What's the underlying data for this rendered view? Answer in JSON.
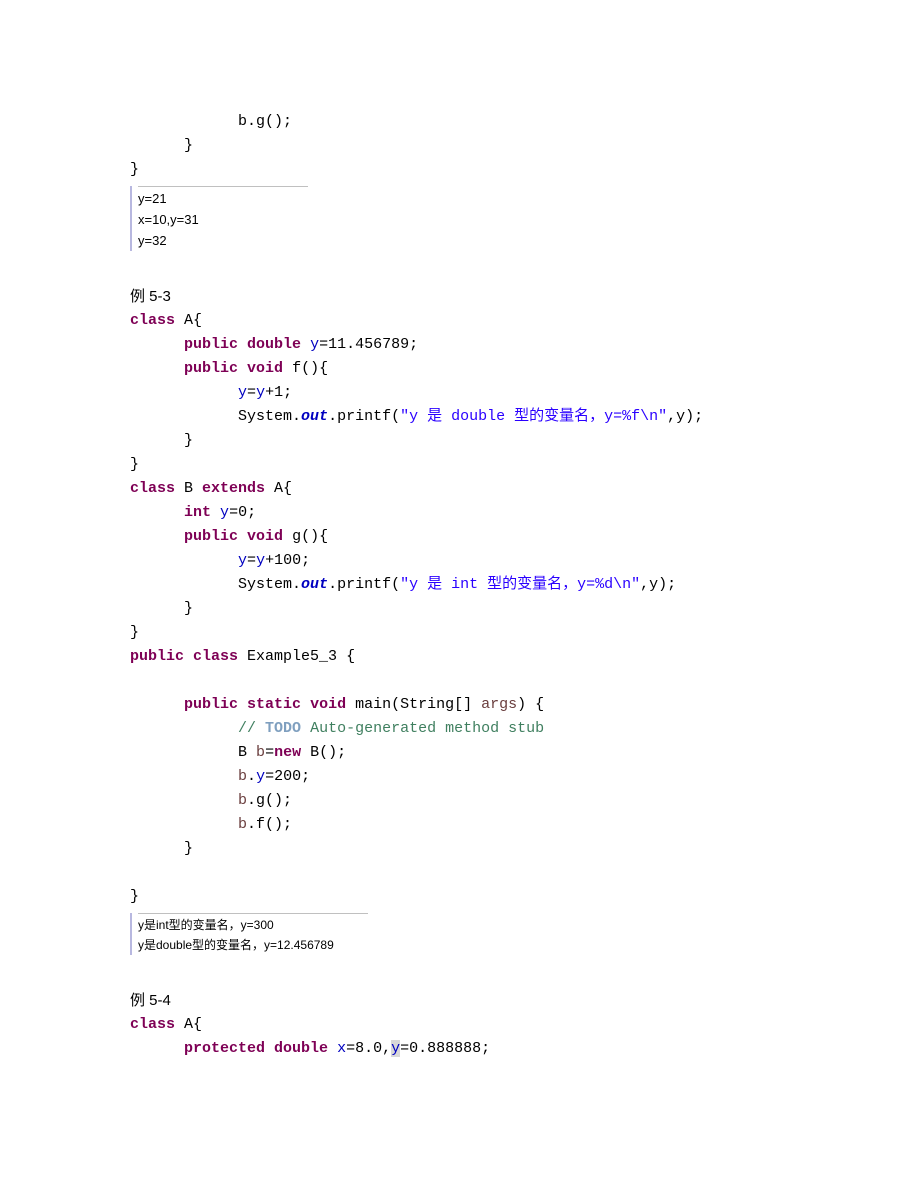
{
  "topCode": {
    "l1": "            b.g();",
    "l2": "      }",
    "l3": "}"
  },
  "output1": {
    "l1": "y=21",
    "l2": "x=10,y=31",
    "l3": "y=32"
  },
  "label53": "例 5-3",
  "ex53": {
    "class_kw": "class",
    "A": " A{",
    "pub": "public",
    "double": "double",
    "y_decl": "y",
    "y_val": "=11.456789;",
    "void": "void",
    "f_sig": " f(){",
    "y_assign_l": "y",
    "y_assign_r": "=",
    "y_assign_r2": "y",
    "y_assign_r3": "+1;",
    "sys": "System.",
    "out": "out",
    "printf": ".printf(",
    "str1": "\"y 是 double 型的变量名，y=%f\\n\"",
    "printf_end": ",y);",
    "close_brace": "      }",
    "close_brace2": "}",
    "extends": "extends",
    "B": " B ",
    "A2": " A{",
    "int": "int",
    "y0": "y",
    "y0v": "=0;",
    "g_sig": " g(){",
    "y100_l": "y",
    "y100_eq": "=",
    "y100_r": "y",
    "y100_p": "+100;",
    "str2": "\"y 是 int 型的变量名，y=%d\\n\"",
    "ex_class": " Example5_3 {",
    "static": "static",
    "main": " main(String[] ",
    "args": "args",
    "main_end": ") {",
    "todo_pre": "// ",
    "todo": "TODO",
    "todo_post": " Auto-generated method stub",
    "Bb": "B ",
    "bvar": "b",
    "new": "new",
    "Bctor": " B();",
    "by200_l": "b",
    "by200_dot": ".",
    "by200_y": "y",
    "by200_v": "=200;",
    "bg_l": "b",
    "bg_r": ".g();",
    "bf_l": "b",
    "bf_r": ".f();"
  },
  "output2": {
    "l1": "y是int型的变量名，y=300",
    "l2": "y是double型的变量名，y=12.456789"
  },
  "label54": "例 5-4",
  "ex54": {
    "class_kw": "class",
    "A": " A{",
    "protected": "protected",
    "double": "double",
    "x": "x",
    "xval": "=8.0,",
    "y": "y",
    "yval": "=0.888888;"
  }
}
